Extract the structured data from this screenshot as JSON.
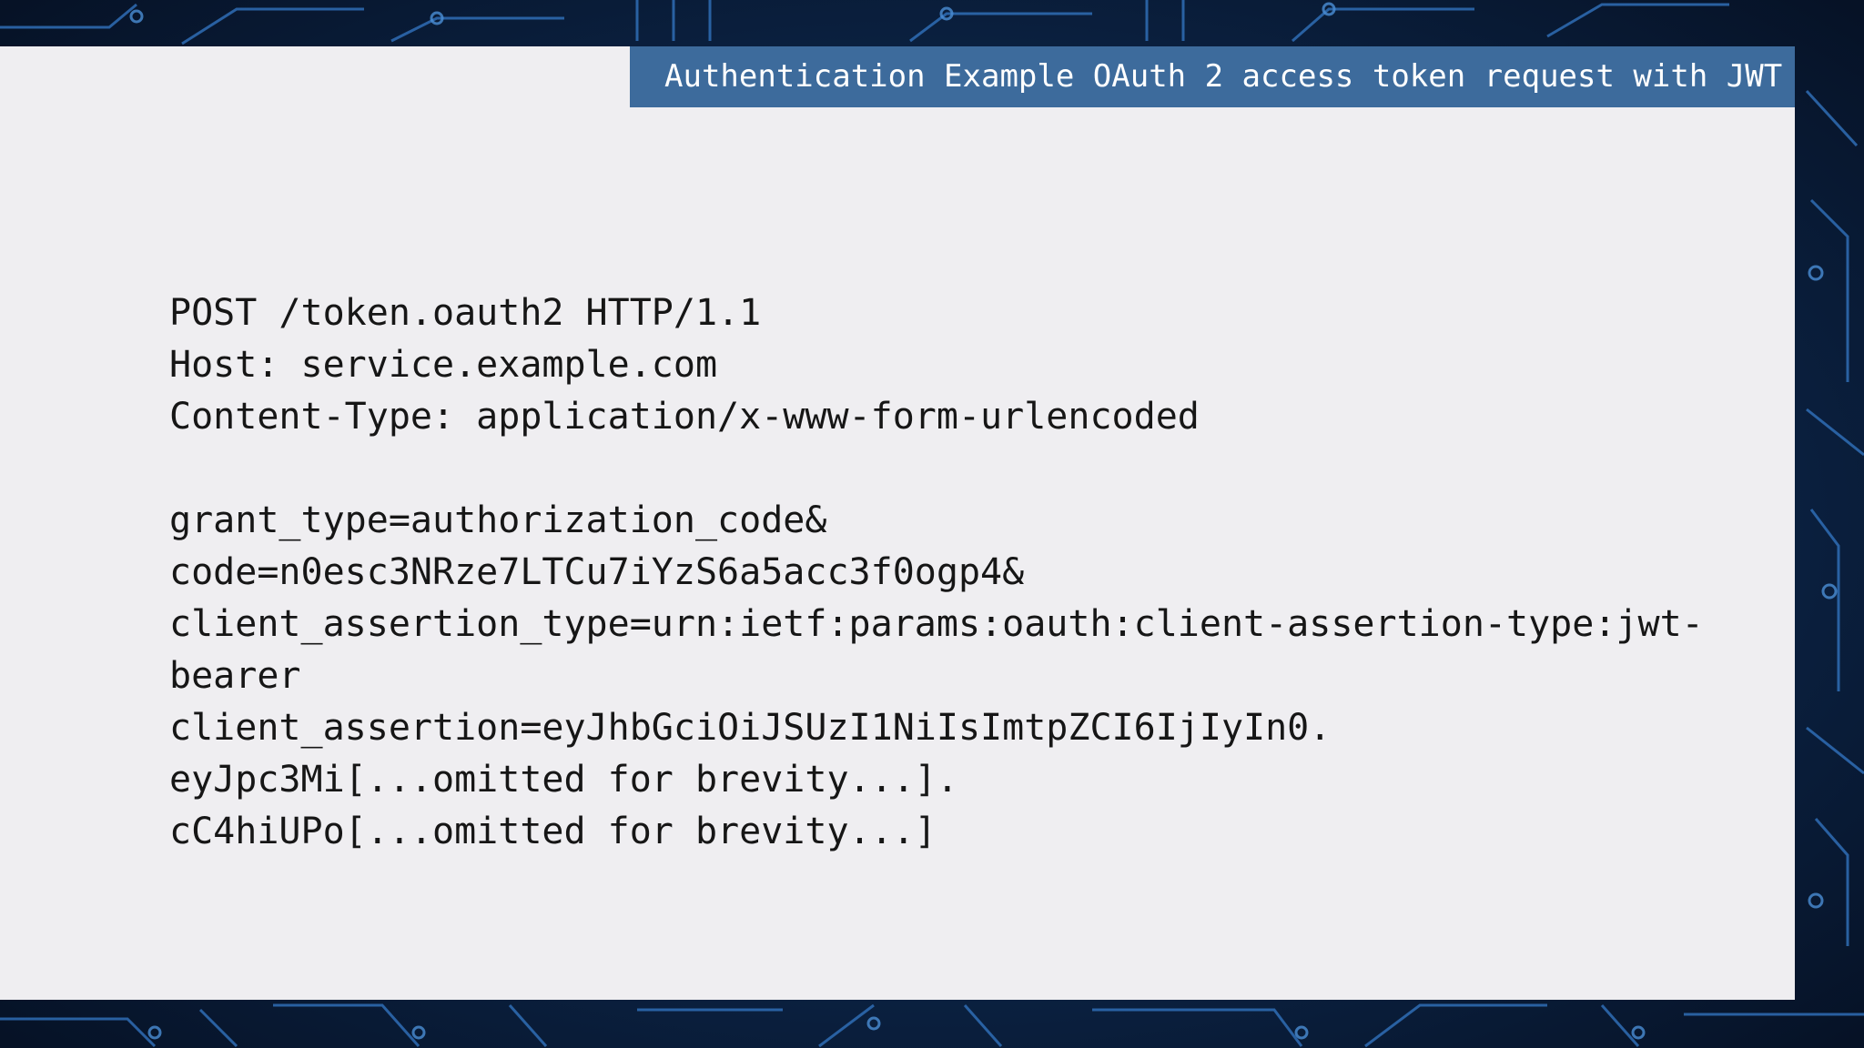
{
  "slide": {
    "title": "Authentication Example OAuth 2 access token request with JWT",
    "request_lines": [
      "POST /token.oauth2 HTTP/1.1",
      "Host: service.example.com",
      "Content-Type: application/x-www-form-urlencoded"
    ],
    "body_lines": [
      "grant_type=authorization_code&",
      "code=n0esc3NRze7LTCu7iYzS6a5acc3f0ogp4&",
      "client_assertion_type=urn:ietf:params:oauth:client-assertion-type:jwt-",
      "bearer",
      "client_assertion=eyJhbGciOiJSUzI1NiIsImtpZCI6IjIyIn0.",
      "eyJpc3Mi[...omitted for brevity...].",
      "cC4hiUPo[...omitted for brevity...]"
    ]
  },
  "colors": {
    "title_bar": "#3d6b9c",
    "slide_background": "#efeef1",
    "page_background": "#0a1a33"
  }
}
